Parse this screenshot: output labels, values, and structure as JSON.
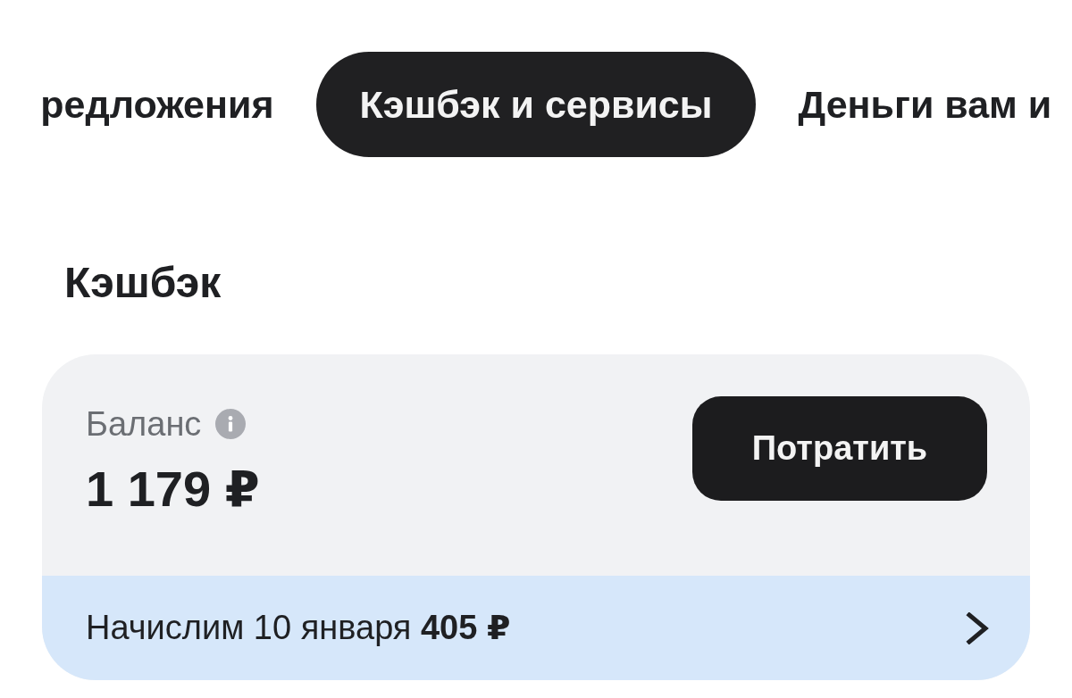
{
  "tabs": [
    {
      "label": "редложения",
      "selected": false
    },
    {
      "label": "Кэшбэк и сервисы",
      "selected": true
    },
    {
      "label": "Деньги вам и",
      "selected": false
    }
  ],
  "section_title": "Кэшбэк",
  "cashback_card": {
    "balance_label": "Баланс",
    "balance": "1 179 ₽",
    "spend_button": "Потратить",
    "accrual": "Начислим 10 января **405 ₽**"
  }
}
